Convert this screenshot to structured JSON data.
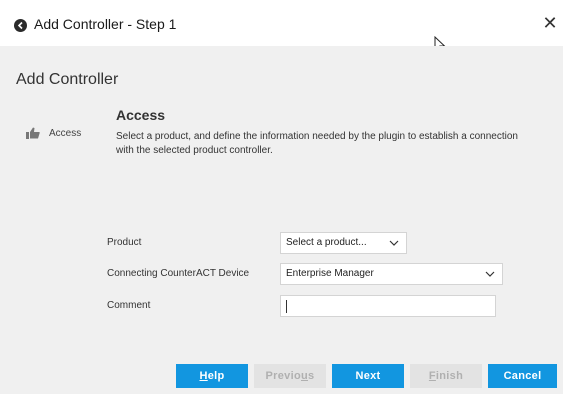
{
  "window": {
    "title": "Add Controller - Step 1",
    "close_symbol": "✕"
  },
  "page": {
    "title": "Add Controller"
  },
  "steps": [
    {
      "label": "Access",
      "icon": "thumbs-up-icon"
    }
  ],
  "section": {
    "title": "Access",
    "description": "Select a product, and define the information needed by the plugin to establish a connection with the selected product controller."
  },
  "form": {
    "product": {
      "label": "Product",
      "value": "Select a product..."
    },
    "device": {
      "label": "Connecting CounterACT Device",
      "value": "Enterprise Manager"
    },
    "comment": {
      "label": "Comment",
      "value": ""
    }
  },
  "buttons": {
    "help": {
      "pre": "",
      "ul": "H",
      "post": "elp"
    },
    "previous": {
      "pre": "Previo",
      "ul": "u",
      "post": "s"
    },
    "next": {
      "label": "Next"
    },
    "finish": {
      "pre": "",
      "ul": "F",
      "post": "inish"
    },
    "cancel": {
      "label": "Cancel"
    }
  },
  "colors": {
    "accent": "#1296e0",
    "disabled_bg": "#e3e3e3",
    "disabled_text": "#b0b0b0",
    "panel_bg": "#f0f0f0"
  }
}
